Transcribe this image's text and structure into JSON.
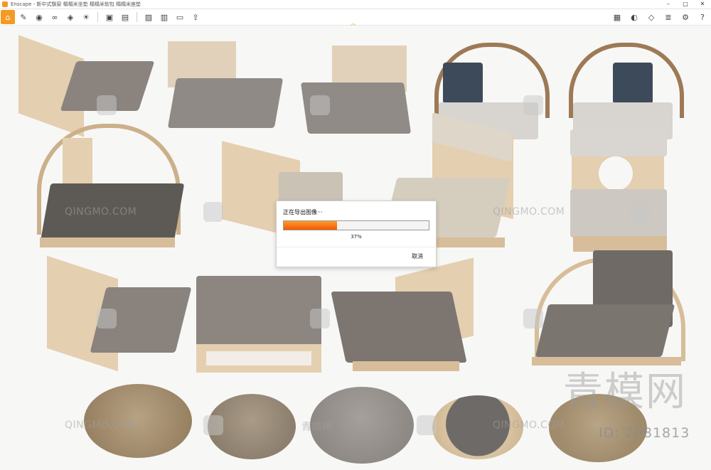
{
  "window": {
    "title": "Enscape - 新中式飘窗 榻榻米坐垫 榻榻米软包 榻榻米座垫"
  },
  "toolbar": {
    "left_icons": [
      "home-icon",
      "tools-icon",
      "camera-icon",
      "binoculars-icon",
      "tag-icon",
      "sun-icon",
      "asset-icon",
      "batch-render-icon",
      "image-icon",
      "video-icon",
      "panorama-icon",
      "export-icon"
    ],
    "right_icons": [
      "library-icon",
      "mask-icon",
      "cube-icon",
      "layers-icon",
      "settings-icon",
      "help-icon"
    ],
    "colors": {
      "accent": "#f39a25"
    }
  },
  "dialog": {
    "title": "正在导出图像···",
    "progress_label": "37%",
    "progress_value": 0.37,
    "cancel_label": "取消"
  },
  "watermarks": {
    "site_text": "QINGMO.COM",
    "cn_small": "青模网",
    "cn_big": "青模网",
    "id_text": "ID: 2081813"
  }
}
